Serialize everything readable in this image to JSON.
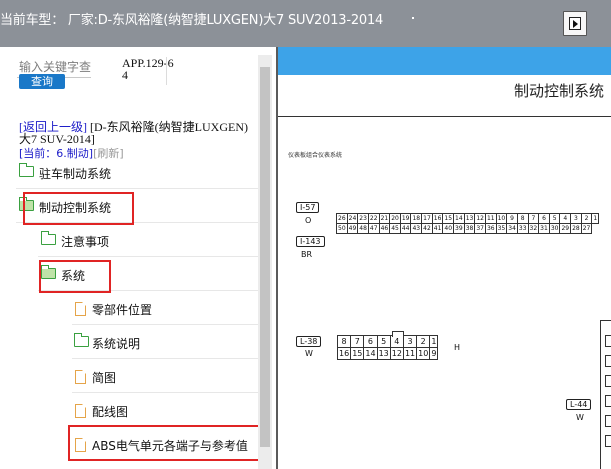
{
  "header": {
    "title": "当前车型：  厂家:D-东风裕隆(纳智捷LUXGEN)大7 SUV2013-2014",
    "nav_icon": "next-arrow-icon"
  },
  "search": {
    "placeholder": "输入关键字查",
    "button_label": "查询",
    "app_code": "APP.129-64"
  },
  "breadcrumb": {
    "back_label": "[返回上一级]",
    "path": " [D-东风裕隆(纳智捷LUXGEN)大7 SUV-2014]",
    "current_prefix": "[当前：",
    "current_value": "6.制动]",
    "refresh_label": "[刷新]"
  },
  "tree": {
    "items": [
      {
        "label": "驻车制动系统",
        "icon": "folder-icon"
      },
      {
        "label": "制动控制系统",
        "icon": "folder-open-icon"
      },
      {
        "label": "注意事项",
        "icon": "folder-icon"
      },
      {
        "label": "系统",
        "icon": "folder-open-icon"
      },
      {
        "label": "零部件位置",
        "icon": "document-icon"
      },
      {
        "label": "系统说明",
        "icon": "folder-icon"
      },
      {
        "label": "简图",
        "icon": "document-icon"
      },
      {
        "label": "配线图",
        "icon": "document-icon"
      },
      {
        "label": "ABS电气单元各端子与参考值",
        "icon": "document-icon"
      }
    ]
  },
  "document": {
    "title": "制动控制系统",
    "subtitle": "仪表板组合仪表系统",
    "connectors": [
      {
        "id": "I-57",
        "color": "O"
      },
      {
        "id": "I-143",
        "color": "BR"
      },
      {
        "id": "L-38",
        "color": "W"
      },
      {
        "id": "L-44",
        "color": "W"
      }
    ],
    "pins_i57_top": [
      "26",
      "24",
      "23",
      "22",
      "21",
      "20",
      "19",
      "18",
      "17",
      "16",
      "15",
      "14",
      "13",
      "12",
      "11",
      "10",
      "9",
      "8",
      "7",
      "6",
      "5",
      "4",
      "3",
      "2",
      "1"
    ],
    "pins_i57_bottom": [
      "50",
      "49",
      "48",
      "47",
      "46",
      "45",
      "44",
      "43",
      "42",
      "41",
      "40",
      "39",
      "38",
      "37",
      "36",
      "35",
      "34",
      "33",
      "32",
      "31",
      "30",
      "29",
      "28",
      "27"
    ],
    "pins_l38_top": [
      "8",
      "7",
      "6",
      "5",
      "4",
      "3",
      "2",
      "1"
    ],
    "pins_l38_bottom": [
      "16",
      "15",
      "14",
      "13",
      "12",
      "11",
      "10",
      "9"
    ],
    "pins_l38_label": "H"
  },
  "colors": {
    "header_bg": "#8c9198",
    "accent_blue": "#3da3e8",
    "button_blue": "#1a78c8",
    "highlight_red": "#e02424",
    "folder_green": "#3aa040",
    "doc_orange": "#e5a449"
  }
}
